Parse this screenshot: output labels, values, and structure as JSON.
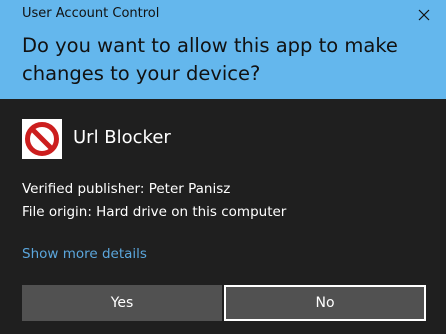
{
  "window": {
    "title": "User Account Control",
    "close_icon": "close-icon"
  },
  "header": {
    "question": "Do you want to allow this app to make changes to your device?"
  },
  "app": {
    "icon": "no-entry-icon",
    "name": "Url Blocker"
  },
  "details": {
    "publisher": "Verified publisher: Peter Panisz",
    "origin": "File origin: Hard drive on this computer",
    "more_link": "Show more details"
  },
  "buttons": {
    "yes": "Yes",
    "no": "No"
  },
  "colors": {
    "header_bg": "#64b7ed",
    "body_bg": "#1f1f1f",
    "link": "#5ba6dc",
    "button_bg": "#515151",
    "icon_red": "#cc1e1e"
  }
}
